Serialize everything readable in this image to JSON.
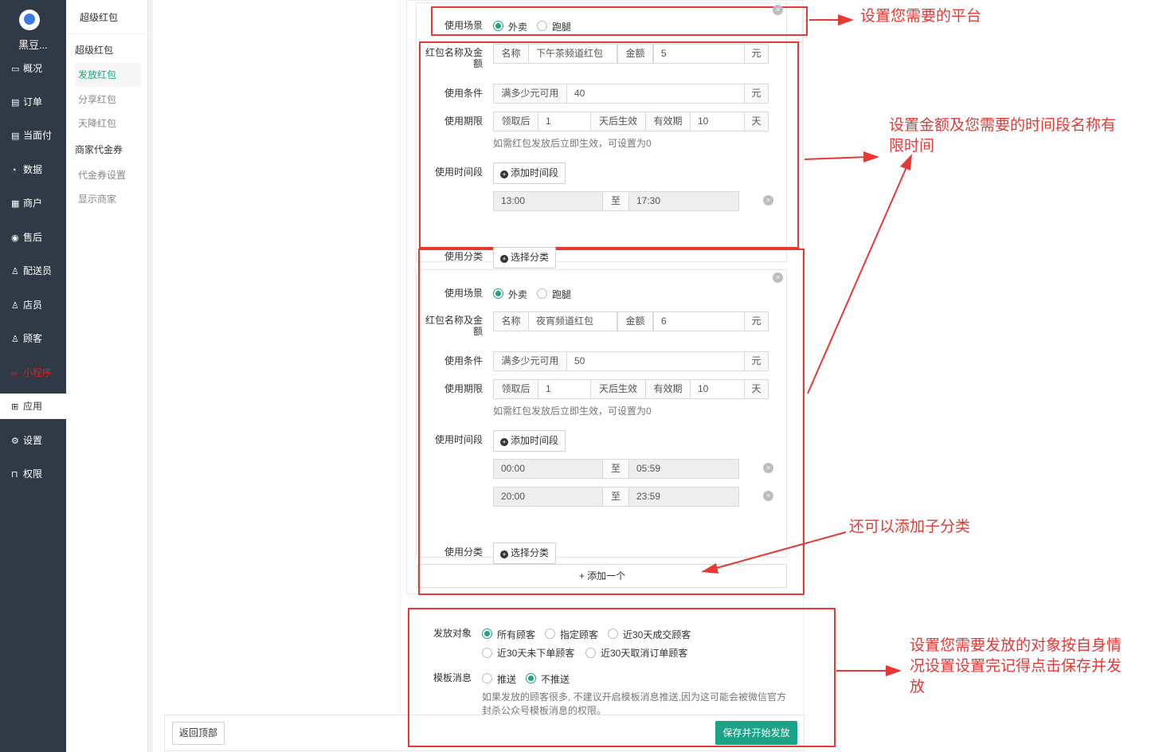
{
  "app": {
    "name": "黑豆..."
  },
  "nav": [
    {
      "icon": "dashboard-icon",
      "glyph": "▭",
      "label": "概况"
    },
    {
      "icon": "order-icon",
      "glyph": "▤",
      "label": "订单"
    },
    {
      "icon": "pay-icon",
      "glyph": "▤",
      "label": "当面付"
    },
    {
      "icon": "data-icon",
      "glyph": "◔",
      "label": "数据"
    },
    {
      "icon": "store-icon",
      "glyph": "▦",
      "label": "商户"
    },
    {
      "icon": "after-sale-icon",
      "glyph": "◉",
      "label": "售后"
    },
    {
      "icon": "courier-icon",
      "glyph": "♙",
      "label": "配送员"
    },
    {
      "icon": "clerk-icon",
      "glyph": "♙",
      "label": "店员"
    },
    {
      "icon": "customer-icon",
      "glyph": "♙",
      "label": "顾客"
    },
    {
      "icon": "miniprogram-icon",
      "glyph": "∞",
      "label": "小程序"
    },
    {
      "icon": "apps-icon",
      "glyph": "⊞",
      "label": "应用"
    },
    {
      "icon": "settings-icon",
      "glyph": "⚙",
      "label": "设置"
    },
    {
      "icon": "lock-icon",
      "glyph": "⊓",
      "label": "权限"
    }
  ],
  "submenu": {
    "title": "超级红包",
    "groups": [
      {
        "label": "超级红包",
        "items": [
          "发放红包",
          "分享红包",
          "天降红包"
        ]
      },
      {
        "label": "商家代金券",
        "items": [
          "代金券设置",
          "显示商家"
        ]
      }
    ]
  },
  "form": {
    "scene_label": "使用场景",
    "scene_options": [
      "外卖",
      "跑腿"
    ],
    "name_amount_label": "红包名称及金额",
    "name_prefix": "名称",
    "amount_prefix": "金额",
    "unit_yuan": "元",
    "condition_label": "使用条件",
    "condition_prefix": "满多少元可用",
    "period_label": "使用期限",
    "period_after": "领取后",
    "period_effect": "天后生效",
    "period_valid": "有效期",
    "period_day": "天",
    "period_hint": "如需红包发放后立即生效，可设置为0",
    "time_label": "使用时间段",
    "add_time_btn": "添加时间段",
    "to": "至",
    "category_label": "使用分类",
    "category_btn": "选择分类",
    "close_glyph": "×",
    "plus_glyph": "+"
  },
  "packets": [
    {
      "name": "下午茶频道红包",
      "amount": "5",
      "condition": "40",
      "after_days": "1",
      "valid_days": "10",
      "times": [
        [
          "13:00",
          "17:30"
        ]
      ]
    },
    {
      "name": "夜宵频道红包",
      "amount": "6",
      "condition": "50",
      "after_days": "1",
      "valid_days": "10",
      "times": [
        [
          "00:00",
          "05:59"
        ],
        [
          "20:00",
          "23:59"
        ]
      ]
    }
  ],
  "add_one": "+ 添加一个",
  "target": {
    "label": "发放对象",
    "options": [
      "所有顾客",
      "指定顾客",
      "近30天成交顾客",
      "近30天未下单顾客",
      "近30天取消订单顾客"
    ]
  },
  "template": {
    "label": "模板消息",
    "options": [
      "推送",
      "不推送"
    ],
    "hint1": "如果发放的顾客很多, 不建议开启模板消息推送,因为这可能会被微信官方",
    "hint2": "封杀公众号模板消息的权限。"
  },
  "footer": {
    "back_top": "返回顶部",
    "save": "保存并开始发放"
  },
  "annotations": {
    "a1": "设置您需要的平台",
    "a2a": "设置金额及您需要的时间段名称有",
    "a2b": "限时间",
    "a3": "还可以添加子分类",
    "a4a": "设置您需要发放的对象按自身情",
    "a4b": "况设置设置完记得点击保存并发",
    "a4c": "放"
  },
  "colors": {
    "sidebar": "#2f3a46",
    "accent": "#1aa387",
    "annotation": "#e53935"
  }
}
